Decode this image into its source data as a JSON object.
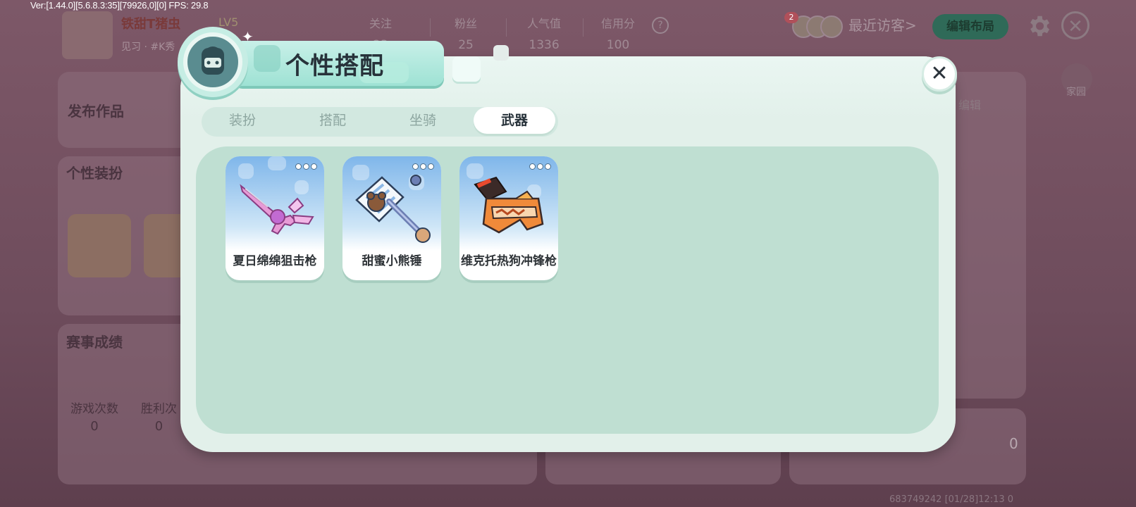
{
  "debug_overlay": "Ver:[1.44.0][5.6.8.3:35][79926,0][0] FPS: 29.8",
  "background_profile": {
    "username": "铁甜T猪虫",
    "level": "LV5",
    "subtitle": "见习 · #K秀",
    "stats": [
      {
        "label": "关注",
        "value": "23"
      },
      {
        "label": "粉丝",
        "value": "25"
      },
      {
        "label": "人气值",
        "value": "1336"
      },
      {
        "label": "信用分",
        "value": "100"
      }
    ],
    "visitor_count": "2",
    "recent_visitors": "最近访客>",
    "edit_layout": "编辑布局",
    "home": "家园",
    "sections": {
      "publish": "发布作品",
      "outfits": "个性装扮",
      "results": "赛事成绩",
      "edit": "编辑",
      "games_played_label": "游戏次数",
      "games_played": "0",
      "wins_label": "胜利次",
      "wins": "0",
      "bottom_value": "0"
    },
    "footer_id": "683749242",
    "footer_time": "[01/28]12:13 0"
  },
  "modal": {
    "title": "个性搭配",
    "tabs": [
      {
        "label": "装扮",
        "active": false
      },
      {
        "label": "搭配",
        "active": false
      },
      {
        "label": "坐骑",
        "active": false
      },
      {
        "label": "武器",
        "active": true
      }
    ],
    "items": [
      {
        "name": "夏日绵绵狙击枪",
        "icon": "pink-sniper-rifle-icon"
      },
      {
        "name": "甜蜜小熊锤",
        "icon": "bear-hammer-icon"
      },
      {
        "name": "维克托热狗冲锋枪",
        "icon": "hotdog-smg-icon"
      }
    ]
  },
  "colors": {
    "modal_bg": "#e2f0ea",
    "content_bg": "#bfdfd2",
    "tab_active": "#ffffff",
    "title_banner": "#9ee2d4"
  }
}
